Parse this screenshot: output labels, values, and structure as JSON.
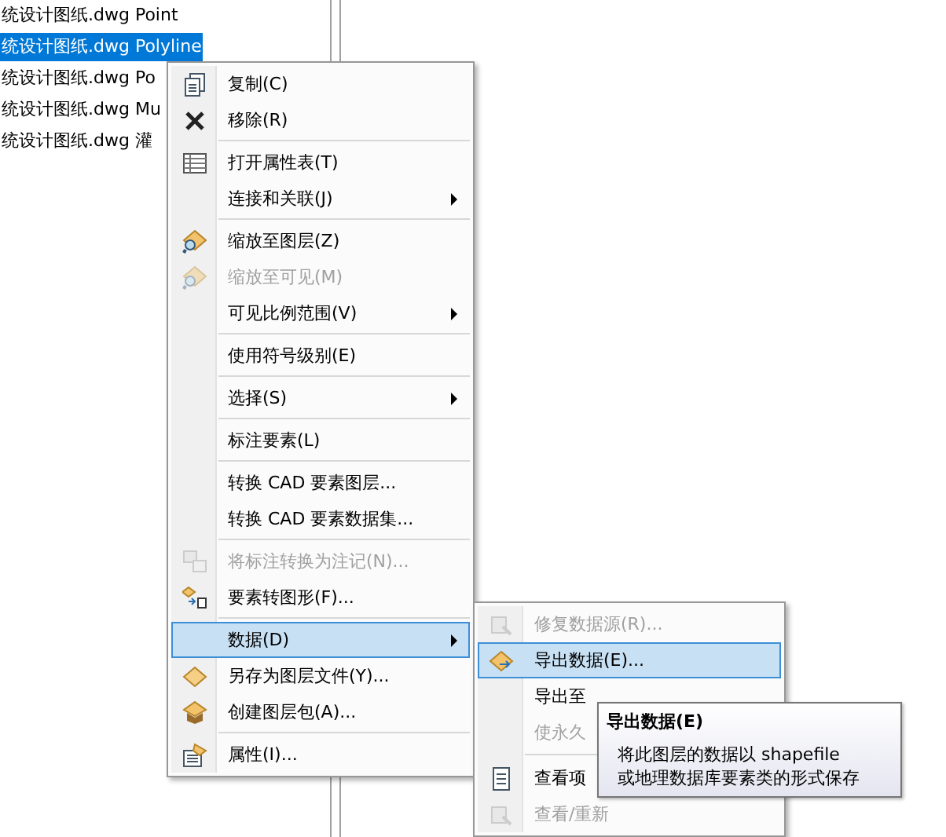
{
  "layer_list": [
    {
      "label": "统设计图纸.dwg Point",
      "selected": false
    },
    {
      "label": "统设计图纸.dwg Polyline",
      "selected": true
    },
    {
      "label": "统设计图纸.dwg Po",
      "selected": false
    },
    {
      "label": "统设计图纸.dwg Mu",
      "selected": false
    },
    {
      "label": "统设计图纸.dwg 灌",
      "selected": false
    }
  ],
  "context_menu": {
    "items": [
      {
        "label": "复制(C)",
        "disabled": false,
        "has_submenu": false,
        "selected": false,
        "separator_before": false
      },
      {
        "label": "移除(R)",
        "disabled": false,
        "has_submenu": false,
        "selected": false,
        "separator_before": false
      },
      {
        "label": "打开属性表(T)",
        "disabled": false,
        "has_submenu": false,
        "selected": false,
        "separator_before": true
      },
      {
        "label": "连接和关联(J)",
        "disabled": false,
        "has_submenu": true,
        "selected": false,
        "separator_before": false
      },
      {
        "label": "缩放至图层(Z)",
        "disabled": false,
        "has_submenu": false,
        "selected": false,
        "separator_before": true
      },
      {
        "label": "缩放至可见(M)",
        "disabled": true,
        "has_submenu": false,
        "selected": false,
        "separator_before": false
      },
      {
        "label": "可见比例范围(V)",
        "disabled": false,
        "has_submenu": true,
        "selected": false,
        "separator_before": false
      },
      {
        "label": "使用符号级别(E)",
        "disabled": false,
        "has_submenu": false,
        "selected": false,
        "separator_before": true
      },
      {
        "label": "选择(S)",
        "disabled": false,
        "has_submenu": true,
        "selected": false,
        "separator_before": true
      },
      {
        "label": "标注要素(L)",
        "disabled": false,
        "has_submenu": false,
        "selected": false,
        "separator_before": true
      },
      {
        "label": "转换 CAD 要素图层...",
        "disabled": false,
        "has_submenu": false,
        "selected": false,
        "separator_before": true
      },
      {
        "label": "转换 CAD 要素数据集...",
        "disabled": false,
        "has_submenu": false,
        "selected": false,
        "separator_before": false
      },
      {
        "label": "将标注转换为注记(N)...",
        "disabled": true,
        "has_submenu": false,
        "selected": false,
        "separator_before": true
      },
      {
        "label": "要素转图形(F)...",
        "disabled": false,
        "has_submenu": false,
        "selected": false,
        "separator_before": false
      },
      {
        "label": "数据(D)",
        "disabled": false,
        "has_submenu": true,
        "selected": true,
        "separator_before": true
      },
      {
        "label": "另存为图层文件(Y)...",
        "disabled": false,
        "has_submenu": false,
        "selected": false,
        "separator_before": false
      },
      {
        "label": "创建图层包(A)...",
        "disabled": false,
        "has_submenu": false,
        "selected": false,
        "separator_before": false
      },
      {
        "label": "属性(I)...",
        "disabled": false,
        "has_submenu": false,
        "selected": false,
        "separator_before": true
      }
    ]
  },
  "submenu": {
    "items": [
      {
        "label": "修复数据源(R)...",
        "disabled": true,
        "selected": false,
        "separator_before": false
      },
      {
        "label": "导出数据(E)...",
        "disabled": false,
        "selected": true,
        "separator_before": false
      },
      {
        "label": "导出至",
        "disabled": false,
        "selected": false,
        "separator_before": false
      },
      {
        "label": "使永久",
        "disabled": true,
        "selected": false,
        "separator_before": false
      },
      {
        "label": "查看项",
        "disabled": false,
        "selected": false,
        "separator_before": true
      },
      {
        "label": "查看/重新",
        "disabled": true,
        "selected": false,
        "separator_before": false
      }
    ]
  },
  "tooltip": {
    "title": "导出数据(E)",
    "description": [
      "将此图层的数据以 shapefile",
      "或地理数据库要素类的形式保存"
    ]
  }
}
